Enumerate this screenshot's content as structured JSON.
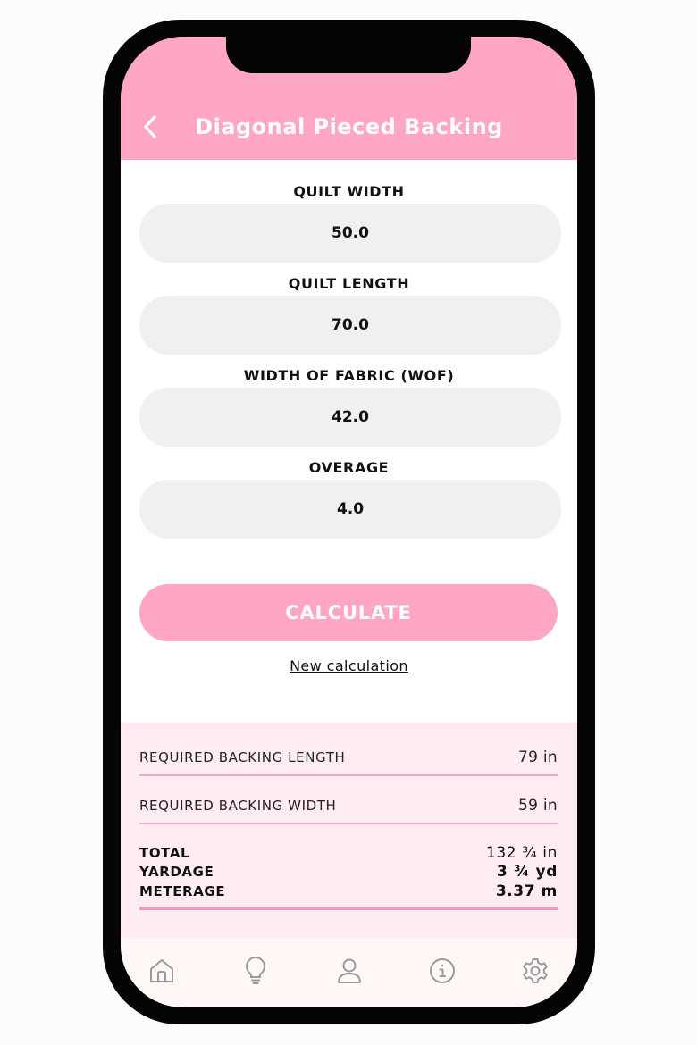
{
  "header": {
    "back_icon": "chevron-left-icon",
    "title": "Diagonal Pieced Backing"
  },
  "form": {
    "fields": [
      {
        "label": "QUILT WIDTH",
        "value": "50.0"
      },
      {
        "label": "QUILT LENGTH",
        "value": "70.0"
      },
      {
        "label": "WIDTH OF FABRIC (WOF)",
        "value": "42.0"
      },
      {
        "label": "OVERAGE",
        "value": "4.0"
      }
    ],
    "calculate_label": "CALCULATE",
    "new_calc_label": "New calculation"
  },
  "results": {
    "backing_length": {
      "label": "REQUIRED BACKING LENGTH",
      "value": "79 in"
    },
    "backing_width": {
      "label": "REQUIRED BACKING WIDTH",
      "value": "59 in"
    },
    "total": {
      "label": "TOTAL",
      "value": "132 ¾ in"
    },
    "yardage": {
      "label": "YARDAGE",
      "value": "3 ¾ yd"
    },
    "meterage": {
      "label": "METERAGE",
      "value": "3.37 m"
    }
  },
  "tabbar": {
    "icons": [
      "home-icon",
      "lightbulb-icon",
      "user-icon",
      "info-icon",
      "settings-icon"
    ]
  },
  "colors": {
    "accent": "#ffa6c5",
    "results_bg": "#ffecf2",
    "input_bg": "#f0f0f0",
    "tabbar_bg": "#fef7f6"
  }
}
